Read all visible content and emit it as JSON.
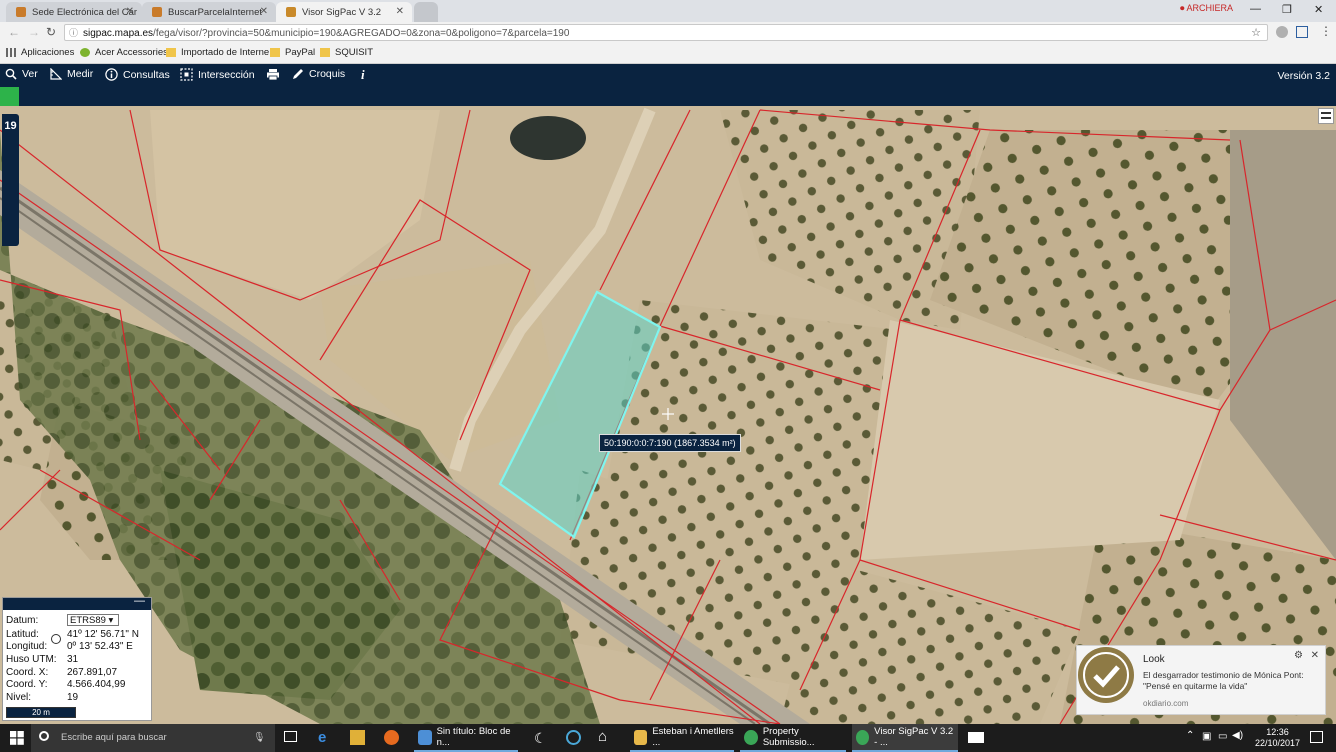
{
  "browser": {
    "tabs": [
      {
        "title": "Sede Electrónica del Car",
        "favicon_color": "#c97b2a",
        "active": false
      },
      {
        "title": "BuscarParcelaInternet",
        "favicon_color": "#c97b2a",
        "active": false
      },
      {
        "title": "Visor SigPac V 3.2",
        "favicon_color": "#c98a2a",
        "active": true
      }
    ],
    "profile_label": "ARCHIERA",
    "url_host": "sigpac.mapa.es",
    "url_path": "/fega/visor/?provincia=50&municipio=190&AGREGADO=0&zona=0&poligono=7&parcela=190",
    "bookmarks": [
      "Aplicaciones",
      "Acer Accessories",
      "Importado de Interne",
      "PayPal",
      "SQUISIT"
    ]
  },
  "app": {
    "tools": [
      {
        "label": "Ver",
        "icon": "search-icon"
      },
      {
        "label": "Medir",
        "icon": "ruler-icon"
      },
      {
        "label": "Consultas",
        "icon": "info-icon"
      },
      {
        "label": "Intersección",
        "icon": "intersection-icon"
      },
      {
        "label": "",
        "icon": "print-icon"
      },
      {
        "label": "Croquis",
        "icon": "pencil-icon"
      },
      {
        "label": "i",
        "icon": "info-italic-icon"
      }
    ],
    "version": "Versión 3.2",
    "zoom_level": "19",
    "accent_color": "#0a2340",
    "progress_color": "#2db34a"
  },
  "map": {
    "parcel_tooltip": "50:190:0:0:7:190 (1867.3534 m²)",
    "parcel_line_color": "#d8262b",
    "selected_color": "#5fd3c9"
  },
  "coords": {
    "datum_label": "Datum:",
    "datum_value": "ETRS89",
    "lat_label": "Latitud:",
    "lat_value": "41º 12' 56.71\" N",
    "lon_label": "Longitud:",
    "lon_value": "0º 13' 52.43\" E",
    "huso_label": "Huso UTM:",
    "huso_value": "31",
    "x_label": "Coord. X:",
    "x_value": "267.891,07",
    "y_label": "Coord. Y:",
    "y_value": "4.566.404,99",
    "nivel_label": "Nivel:",
    "nivel_value": "19",
    "scale": "20 m"
  },
  "notification": {
    "title": "Look",
    "body": "El desgarrador testimonio de Mónica Pont: \"Pensé en quitarme la vida\"",
    "source": "okdiario.com"
  },
  "taskbar": {
    "search_placeholder": "Escribe aquí para buscar",
    "apps": [
      {
        "label": "Sin título: Bloc de n...",
        "color": "#4d8fd6"
      },
      {
        "label": "Esteban i Ametllers ...",
        "color": "#e8b84a"
      },
      {
        "label": "Property Submissio...",
        "color": "#3aa657"
      },
      {
        "label": "Visor SigPac V 3.2 - ...",
        "color": "#3aa657"
      }
    ],
    "time": "12:36",
    "date": "22/10/2017"
  }
}
